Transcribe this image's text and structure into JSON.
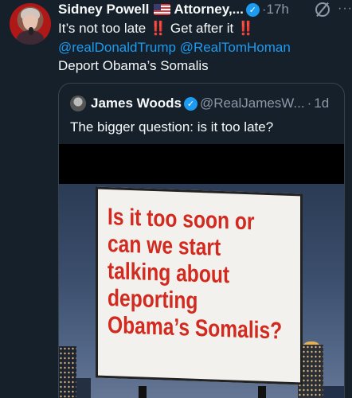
{
  "tweet": {
    "author_name": "Sidney Powell",
    "author_title": "Attorney,...",
    "timestamp": "17h",
    "line1_a": "It’s not too late",
    "line1_b": "Get after it",
    "exclaim": "‼️",
    "mentions": "@realDonaldTrump @RealTomHoman",
    "line3": "Deport Obama’s Somalis"
  },
  "quote": {
    "author_name": "James Woods",
    "handle": "@RealJamesW...",
    "separator": "·",
    "timestamp": "1d",
    "text": "The bigger question: is it too late?"
  },
  "billboard": {
    "lines": [
      "Is it too soon or",
      "can we start",
      "talking about",
      "deporting",
      "Obama’s Somalis?"
    ]
  },
  "icons": {
    "verified": "verified-badge-icon",
    "more": "more-icon",
    "grok": "grok-icon",
    "flag": "us-flag-icon"
  },
  "colors": {
    "background": "#15202b",
    "link": "#1d9bf0",
    "muted": "#8b98a5",
    "billboard_text": "#d22a1e"
  }
}
